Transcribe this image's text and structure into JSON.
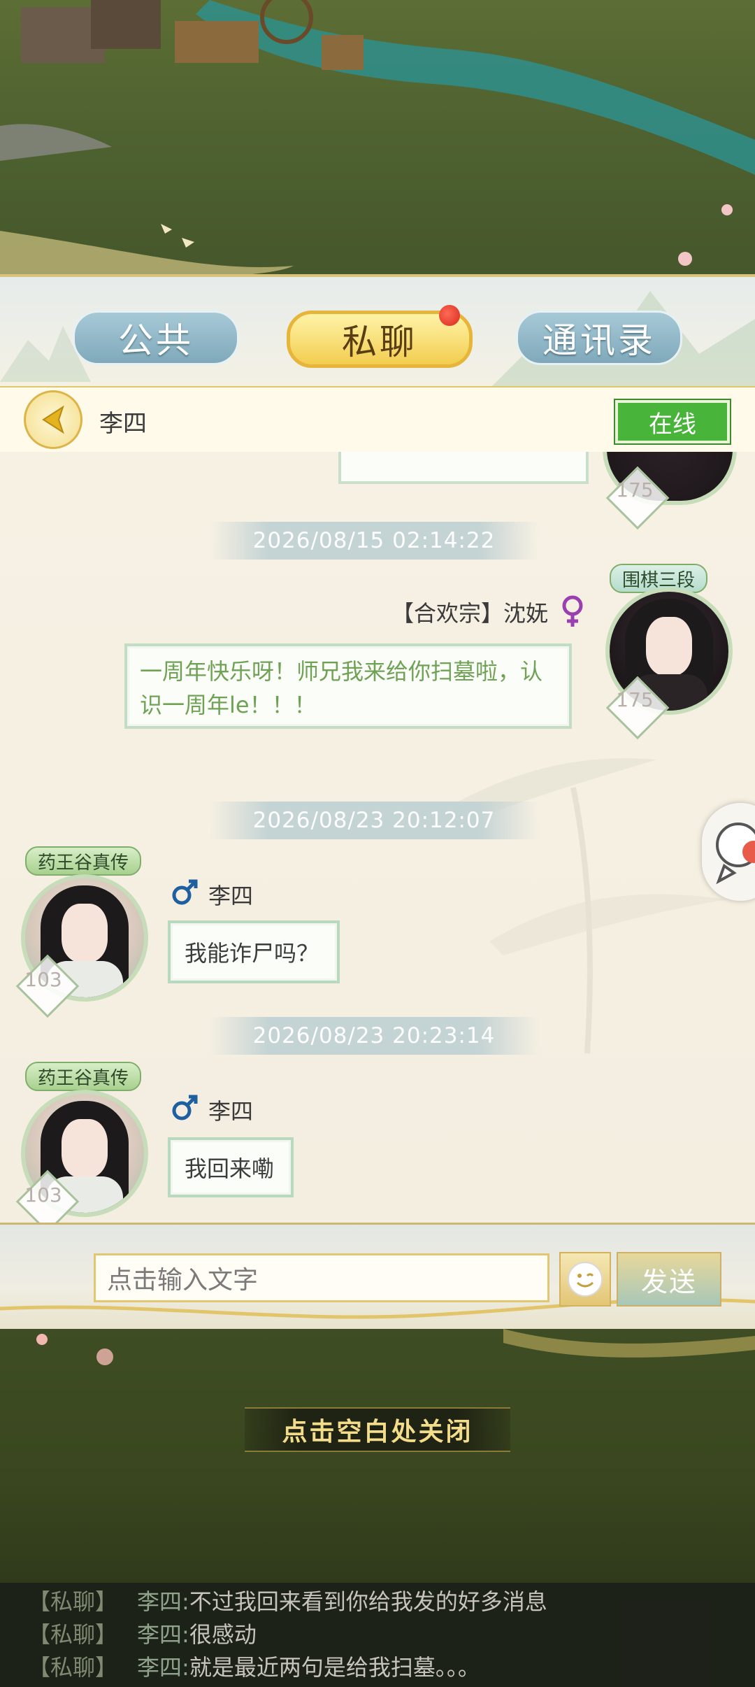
{
  "tabs": {
    "public": "公共",
    "private": "私聊",
    "contacts": "通讯录"
  },
  "header": {
    "contact_name": "李四",
    "status": "在线"
  },
  "messages": [
    {
      "timestamp": "2026/08/15  02:14:22",
      "sender": "【合欢宗】沈妩",
      "rank": "围棋三段",
      "level": "175",
      "text": "一周年快乐呀！师兄我来给你扫墓啦，认识一周年le！！！"
    },
    {
      "timestamp": "2026/08/23  20:12:07",
      "sender": "李四",
      "rank": "药王谷真传",
      "level": "103",
      "text": "我能诈尸吗？"
    },
    {
      "timestamp": "2026/08/23  20:23:14",
      "sender": "李四",
      "rank": "药王谷真传",
      "level": "103",
      "text": "我回来嘞"
    }
  ],
  "partial_top_level": "175",
  "input": {
    "placeholder": "点击输入文字",
    "send_label": "发送"
  },
  "close_hint": "点击空白处关闭",
  "log": [
    {
      "channel": "【私聊】",
      "name": "李四:",
      "text": "不过我回来看到你给我发的好多消息"
    },
    {
      "channel": "【私聊】",
      "name": "李四:",
      "text": "很感动"
    },
    {
      "channel": "【私聊】",
      "name": "李四:",
      "text": "就是最近两句是给我扫墓。。。"
    }
  ],
  "colors": {
    "online_green": "#48b43a",
    "tab_active": "#f2cd4f",
    "tab_normal": "#7fa9bb",
    "badge_red": "#d52a1c"
  }
}
